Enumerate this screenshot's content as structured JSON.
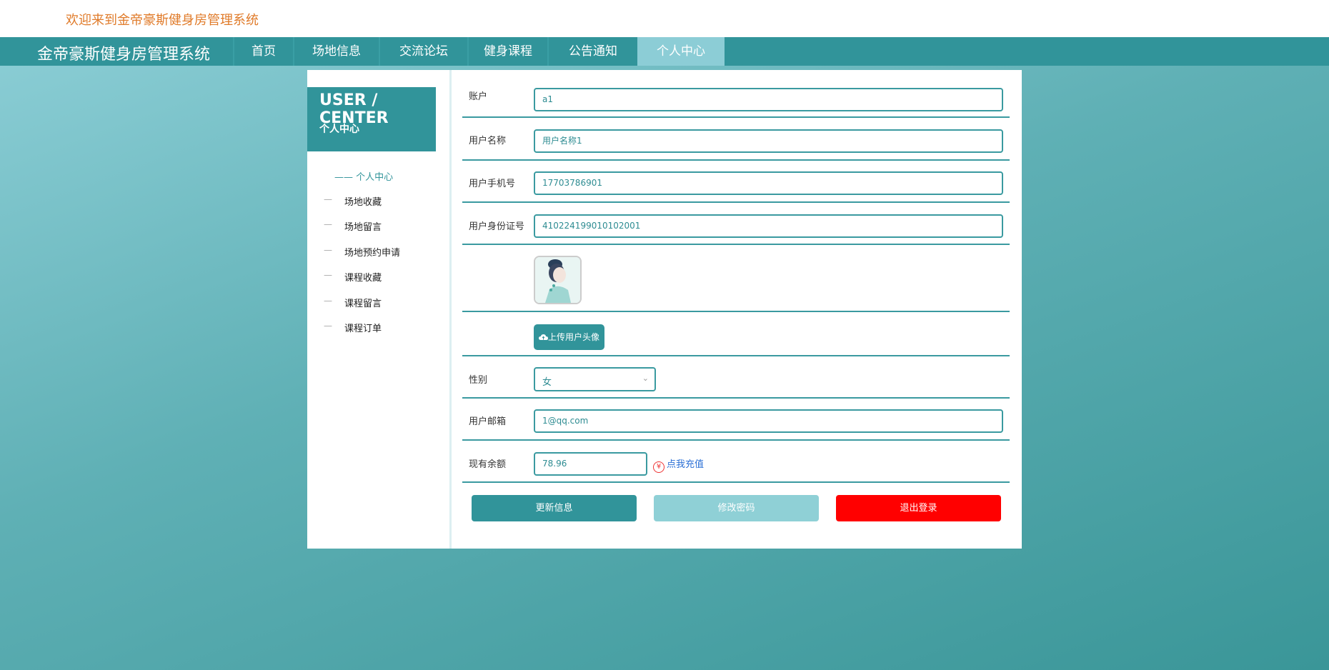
{
  "header": {
    "welcome": "欢迎来到金帝豪斯健身房管理系统"
  },
  "nav": {
    "brand": "金帝豪斯健身房管理系统",
    "items": [
      {
        "label": "首页"
      },
      {
        "label": "场地信息"
      },
      {
        "label": "交流论坛"
      },
      {
        "label": "健身课程"
      },
      {
        "label": "公告通知"
      },
      {
        "label": "个人中心"
      }
    ],
    "active_color": "#8ccdd6",
    "bar_color": "#31949a"
  },
  "sidebar": {
    "title_en": "USER / CENTER",
    "title_cn": "个人中心",
    "active_item": "—— 个人中心",
    "items": [
      {
        "dash": "—",
        "label": "场地收藏"
      },
      {
        "dash": "—",
        "label": "场地留言"
      },
      {
        "dash": "—",
        "label": "场地预约申请"
      },
      {
        "dash": "—",
        "label": "课程收藏"
      },
      {
        "dash": "—",
        "label": "课程留言"
      },
      {
        "dash": "—",
        "label": "课程订单"
      }
    ]
  },
  "form": {
    "account": {
      "label": "账户",
      "value": "a1"
    },
    "username": {
      "label": "用户名称",
      "value": "用户名称1"
    },
    "phone": {
      "label": "用户手机号",
      "value": "17703786901"
    },
    "id_card": {
      "label": "用户身份证号",
      "value": "410224199010102001"
    },
    "avatar_upload": {
      "label": "上传用户头像",
      "icon": "cloud-upload-icon"
    },
    "gender": {
      "label": "性别",
      "value": "女"
    },
    "email": {
      "label": "用户邮箱",
      "value": "1@qq.com"
    },
    "balance": {
      "label": "现有余额",
      "value": "78.96",
      "recharge_label": "点我充值",
      "icon": "yuan-icon",
      "icon_glyph": "¥"
    }
  },
  "actions": {
    "update": {
      "label": "更新信息",
      "color": "#31949a"
    },
    "change_password": {
      "label": "修改密码",
      "color": "#8fd0d6"
    },
    "logout": {
      "label": "退出登录",
      "color": "#ff0000"
    }
  }
}
